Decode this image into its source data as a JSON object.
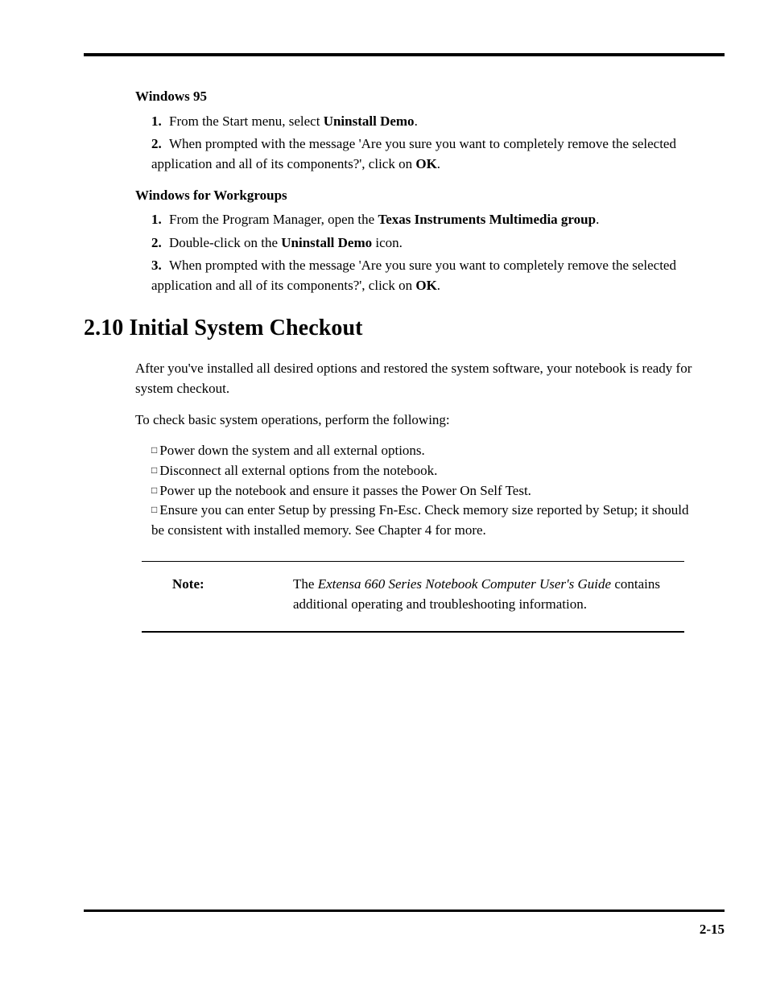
{
  "sec1": {
    "heading_a": "Windows 95",
    "a1_pre": "From the Start menu, select ",
    "a1_bold": "Uninstall Demo",
    "a1_post": ".",
    "a2_pre": "When prompted with the message 'Are you sure you want to completely remove the selected application and all of its components?', click on ",
    "a2_bold": "OK",
    "a2_post": ".",
    "heading_b": "Windows for Workgroups",
    "b1_pre": "From the Program Manager, open the ",
    "b1_bold": "Texas Instruments Multimedia group",
    "b1_post": ".",
    "b2_pre": "Double-click on the ",
    "b2_bold": "Uninstall Demo",
    "b2_post": " icon.",
    "b3_pre": "When prompted with the message 'Are you sure you want to completely remove the selected application and all of its components?', click on ",
    "b3_bold": "OK",
    "b3_post": "."
  },
  "section_title": "2.10 Initial System Checkout",
  "body": {
    "p1": "After you've installed all desired options and restored the system software, your notebook is ready for system checkout.",
    "p2": "To check basic system operations, perform the following:",
    "bullets": [
      "Power down the system and all external options.",
      "Disconnect all external options from the notebook.",
      "Power up the notebook and ensure it passes the Power On Self Test.",
      "Ensure you can enter Setup by pressing Fn-Esc. Check memory size reported by Setup; it should be consistent with installed memory. See Chapter 4 for more."
    ],
    "p3": ""
  },
  "note": {
    "label": "Note:",
    "text_pre": "The ",
    "text_italic": "Extensa  660 Series Notebook Computer User's Guide",
    "text_post": " contains additional operating and troubleshooting information."
  },
  "page_number": "2-15"
}
